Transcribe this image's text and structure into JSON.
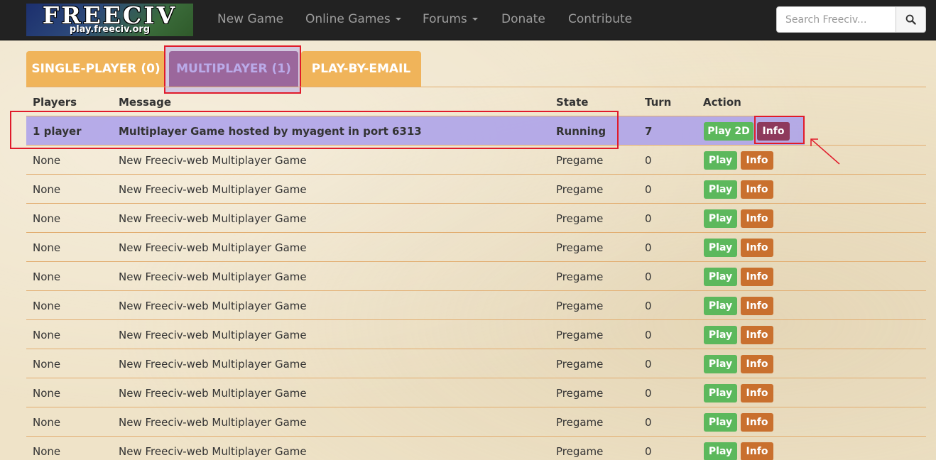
{
  "brand": {
    "title": "FREECIV",
    "subtitle": "play.freeciv.org"
  },
  "nav": {
    "items": [
      {
        "label": "New Game",
        "dropdown": false
      },
      {
        "label": "Online Games",
        "dropdown": true
      },
      {
        "label": "Forums",
        "dropdown": true
      },
      {
        "label": "Donate",
        "dropdown": false
      },
      {
        "label": "Contribute",
        "dropdown": false
      }
    ],
    "search_placeholder": "Search Freeciv...",
    "search_icon": "search-icon"
  },
  "tabs": [
    {
      "label": "SINGLE-PLAYER (0)",
      "active": false
    },
    {
      "label": "MULTIPLAYER (1)",
      "active": true
    },
    {
      "label": "PLAY-BY-EMAIL",
      "active": false
    }
  ],
  "table": {
    "headers": [
      "Players",
      "Message",
      "State",
      "Turn",
      "Action"
    ],
    "rows": [
      {
        "players": "1 player",
        "message": "Multiplayer Game hosted by myagent in port 6313",
        "state": "Running",
        "turn": "7",
        "play_label": "Play 2D",
        "info_label": "Info",
        "highlighted": true
      },
      {
        "players": "None",
        "message": "New Freeciv-web Multiplayer Game",
        "state": "Pregame",
        "turn": "0",
        "play_label": "Play",
        "info_label": "Info",
        "highlighted": false
      },
      {
        "players": "None",
        "message": "New Freeciv-web Multiplayer Game",
        "state": "Pregame",
        "turn": "0",
        "play_label": "Play",
        "info_label": "Info",
        "highlighted": false
      },
      {
        "players": "None",
        "message": "New Freeciv-web Multiplayer Game",
        "state": "Pregame",
        "turn": "0",
        "play_label": "Play",
        "info_label": "Info",
        "highlighted": false
      },
      {
        "players": "None",
        "message": "New Freeciv-web Multiplayer Game",
        "state": "Pregame",
        "turn": "0",
        "play_label": "Play",
        "info_label": "Info",
        "highlighted": false
      },
      {
        "players": "None",
        "message": "New Freeciv-web Multiplayer Game",
        "state": "Pregame",
        "turn": "0",
        "play_label": "Play",
        "info_label": "Info",
        "highlighted": false
      },
      {
        "players": "None",
        "message": "New Freeciv-web Multiplayer Game",
        "state": "Pregame",
        "turn": "0",
        "play_label": "Play",
        "info_label": "Info",
        "highlighted": false
      },
      {
        "players": "None",
        "message": "New Freeciv-web Multiplayer Game",
        "state": "Pregame",
        "turn": "0",
        "play_label": "Play",
        "info_label": "Info",
        "highlighted": false
      },
      {
        "players": "None",
        "message": "New Freeciv-web Multiplayer Game",
        "state": "Pregame",
        "turn": "0",
        "play_label": "Play",
        "info_label": "Info",
        "highlighted": false
      },
      {
        "players": "None",
        "message": "New Freeciv-web Multiplayer Game",
        "state": "Pregame",
        "turn": "0",
        "play_label": "Play",
        "info_label": "Info",
        "highlighted": false
      },
      {
        "players": "None",
        "message": "New Freeciv-web Multiplayer Game",
        "state": "Pregame",
        "turn": "0",
        "play_label": "Play",
        "info_label": "Info",
        "highlighted": false
      },
      {
        "players": "None",
        "message": "New Freeciv-web Multiplayer Game",
        "state": "Pregame",
        "turn": "0",
        "play_label": "Play",
        "info_label": "Info",
        "highlighted": false
      }
    ]
  },
  "colors": {
    "navbar": "#222222",
    "tab_inactive": "#f0b45a",
    "tab_active": "#8e3a5c",
    "play_button": "#5cb85c",
    "info_button": "#c9702e",
    "annotation": "#e01b2b",
    "highlight": "#b9b2ea"
  }
}
